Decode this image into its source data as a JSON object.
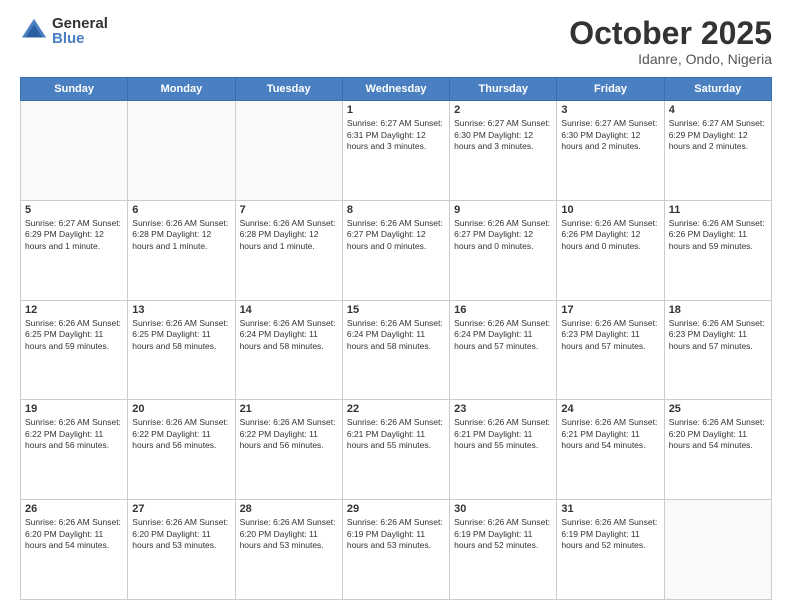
{
  "header": {
    "logo_general": "General",
    "logo_blue": "Blue",
    "month": "October 2025",
    "location": "Idanre, Ondo, Nigeria"
  },
  "weekdays": [
    "Sunday",
    "Monday",
    "Tuesday",
    "Wednesday",
    "Thursday",
    "Friday",
    "Saturday"
  ],
  "weeks": [
    [
      {
        "day": "",
        "info": ""
      },
      {
        "day": "",
        "info": ""
      },
      {
        "day": "",
        "info": ""
      },
      {
        "day": "1",
        "info": "Sunrise: 6:27 AM\nSunset: 6:31 PM\nDaylight: 12 hours\nand 3 minutes."
      },
      {
        "day": "2",
        "info": "Sunrise: 6:27 AM\nSunset: 6:30 PM\nDaylight: 12 hours\nand 3 minutes."
      },
      {
        "day": "3",
        "info": "Sunrise: 6:27 AM\nSunset: 6:30 PM\nDaylight: 12 hours\nand 2 minutes."
      },
      {
        "day": "4",
        "info": "Sunrise: 6:27 AM\nSunset: 6:29 PM\nDaylight: 12 hours\nand 2 minutes."
      }
    ],
    [
      {
        "day": "5",
        "info": "Sunrise: 6:27 AM\nSunset: 6:29 PM\nDaylight: 12 hours\nand 1 minute."
      },
      {
        "day": "6",
        "info": "Sunrise: 6:26 AM\nSunset: 6:28 PM\nDaylight: 12 hours\nand 1 minute."
      },
      {
        "day": "7",
        "info": "Sunrise: 6:26 AM\nSunset: 6:28 PM\nDaylight: 12 hours\nand 1 minute."
      },
      {
        "day": "8",
        "info": "Sunrise: 6:26 AM\nSunset: 6:27 PM\nDaylight: 12 hours\nand 0 minutes."
      },
      {
        "day": "9",
        "info": "Sunrise: 6:26 AM\nSunset: 6:27 PM\nDaylight: 12 hours\nand 0 minutes."
      },
      {
        "day": "10",
        "info": "Sunrise: 6:26 AM\nSunset: 6:26 PM\nDaylight: 12 hours\nand 0 minutes."
      },
      {
        "day": "11",
        "info": "Sunrise: 6:26 AM\nSunset: 6:26 PM\nDaylight: 11 hours\nand 59 minutes."
      }
    ],
    [
      {
        "day": "12",
        "info": "Sunrise: 6:26 AM\nSunset: 6:25 PM\nDaylight: 11 hours\nand 59 minutes."
      },
      {
        "day": "13",
        "info": "Sunrise: 6:26 AM\nSunset: 6:25 PM\nDaylight: 11 hours\nand 58 minutes."
      },
      {
        "day": "14",
        "info": "Sunrise: 6:26 AM\nSunset: 6:24 PM\nDaylight: 11 hours\nand 58 minutes."
      },
      {
        "day": "15",
        "info": "Sunrise: 6:26 AM\nSunset: 6:24 PM\nDaylight: 11 hours\nand 58 minutes."
      },
      {
        "day": "16",
        "info": "Sunrise: 6:26 AM\nSunset: 6:24 PM\nDaylight: 11 hours\nand 57 minutes."
      },
      {
        "day": "17",
        "info": "Sunrise: 6:26 AM\nSunset: 6:23 PM\nDaylight: 11 hours\nand 57 minutes."
      },
      {
        "day": "18",
        "info": "Sunrise: 6:26 AM\nSunset: 6:23 PM\nDaylight: 11 hours\nand 57 minutes."
      }
    ],
    [
      {
        "day": "19",
        "info": "Sunrise: 6:26 AM\nSunset: 6:22 PM\nDaylight: 11 hours\nand 56 minutes."
      },
      {
        "day": "20",
        "info": "Sunrise: 6:26 AM\nSunset: 6:22 PM\nDaylight: 11 hours\nand 56 minutes."
      },
      {
        "day": "21",
        "info": "Sunrise: 6:26 AM\nSunset: 6:22 PM\nDaylight: 11 hours\nand 56 minutes."
      },
      {
        "day": "22",
        "info": "Sunrise: 6:26 AM\nSunset: 6:21 PM\nDaylight: 11 hours\nand 55 minutes."
      },
      {
        "day": "23",
        "info": "Sunrise: 6:26 AM\nSunset: 6:21 PM\nDaylight: 11 hours\nand 55 minutes."
      },
      {
        "day": "24",
        "info": "Sunrise: 6:26 AM\nSunset: 6:21 PM\nDaylight: 11 hours\nand 54 minutes."
      },
      {
        "day": "25",
        "info": "Sunrise: 6:26 AM\nSunset: 6:20 PM\nDaylight: 11 hours\nand 54 minutes."
      }
    ],
    [
      {
        "day": "26",
        "info": "Sunrise: 6:26 AM\nSunset: 6:20 PM\nDaylight: 11 hours\nand 54 minutes."
      },
      {
        "day": "27",
        "info": "Sunrise: 6:26 AM\nSunset: 6:20 PM\nDaylight: 11 hours\nand 53 minutes."
      },
      {
        "day": "28",
        "info": "Sunrise: 6:26 AM\nSunset: 6:20 PM\nDaylight: 11 hours\nand 53 minutes."
      },
      {
        "day": "29",
        "info": "Sunrise: 6:26 AM\nSunset: 6:19 PM\nDaylight: 11 hours\nand 53 minutes."
      },
      {
        "day": "30",
        "info": "Sunrise: 6:26 AM\nSunset: 6:19 PM\nDaylight: 11 hours\nand 52 minutes."
      },
      {
        "day": "31",
        "info": "Sunrise: 6:26 AM\nSunset: 6:19 PM\nDaylight: 11 hours\nand 52 minutes."
      },
      {
        "day": "",
        "info": ""
      }
    ]
  ]
}
